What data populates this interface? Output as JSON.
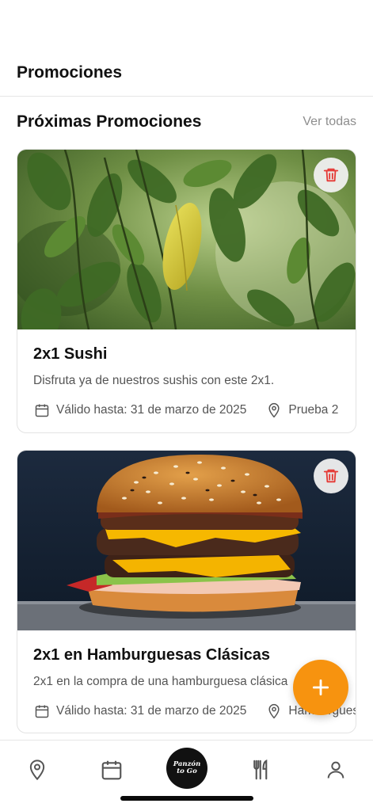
{
  "header": {
    "title": "Promociones"
  },
  "section": {
    "title": "Próximas Promociones",
    "see_all": "Ver todas"
  },
  "promotions": [
    {
      "title": "2x1 Sushi",
      "description": "Disfruta ya de nuestros sushis con este 2x1.",
      "valid_until": "Válido hasta: 31 de marzo de 2025",
      "location": "Prueba 2",
      "image": "plant-leaves-photo"
    },
    {
      "title": "2x1 en Hamburguesas Clásicas",
      "description": "2x1 en la compra de una hamburguesa clásica",
      "valid_until": "Válido hasta: 31 de marzo de 2025",
      "location": "Hamburguesas",
      "image": "burger-photo"
    }
  ],
  "fab": {
    "icon": "plus-icon",
    "color": "#f7930f"
  },
  "bottom_nav": {
    "items": [
      "location-icon",
      "calendar-icon",
      "logo",
      "utensils-icon",
      "user-icon"
    ],
    "logo_text_line1": "Panzón",
    "logo_text_line2": "to Go"
  },
  "colors": {
    "accent": "#f7930f",
    "trash": "#e53935",
    "muted": "#8e8e8e"
  }
}
